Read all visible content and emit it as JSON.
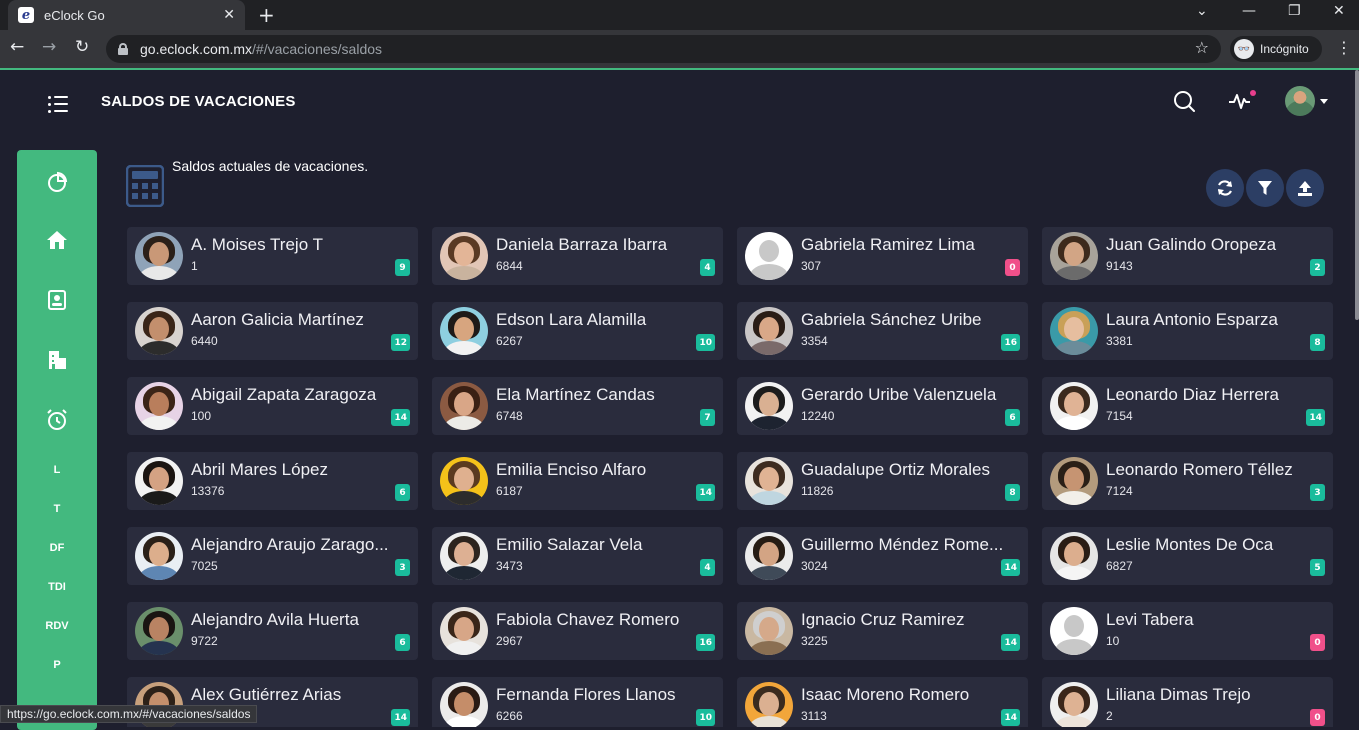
{
  "browser": {
    "tab_title": "eClock Go",
    "favicon_letter": "e",
    "new_tab": "+",
    "url_host": "go.eclock.com.mx",
    "url_path": "/#/vacaciones/saldos",
    "incognito_label": "Incógnito",
    "status_url": "https://go.eclock.com.mx/#/vacaciones/saldos"
  },
  "header": {
    "title": "SALDOS DE VACACIONES",
    "icons": [
      "search-icon",
      "activity-icon",
      "user-avatar"
    ],
    "notification_color": "#e83e8c"
  },
  "sidebar": {
    "color": "#43b97f",
    "icons": [
      "chart-pie-icon",
      "home-icon",
      "contact-card-icon",
      "building-icon",
      "alarm-clock-icon"
    ],
    "text_items": [
      "L",
      "T",
      "DF",
      "TDI",
      "RDV",
      "P"
    ]
  },
  "content": {
    "subtitle": "Saldos actuales de vacaciones.",
    "actions": [
      "refresh-icon",
      "filter-icon",
      "upload-icon"
    ]
  },
  "badge_colors": {
    "positive": "#1abc9c",
    "zero": "#f0508a"
  },
  "employees": [
    {
      "name": "A. Moises Trejo T",
      "id": "1",
      "days": "9",
      "avatar": "m1"
    },
    {
      "name": "Daniela Barraza Ibarra",
      "id": "6844",
      "days": "4",
      "avatar": "f1"
    },
    {
      "name": "Gabriela Ramirez Lima",
      "id": "307",
      "days": "0",
      "avatar": "none"
    },
    {
      "name": "Juan Galindo Oropeza",
      "id": "9143",
      "days": "2",
      "avatar": "m2"
    },
    {
      "name": "Aaron Galicia Martínez",
      "id": "6440",
      "days": "12",
      "avatar": "m3"
    },
    {
      "name": "Edson Lara Alamilla",
      "id": "6267",
      "days": "10",
      "avatar": "m4"
    },
    {
      "name": "Gabriela Sánchez Uribe",
      "id": "3354",
      "days": "16",
      "avatar": "f2"
    },
    {
      "name": "Laura Antonio Esparza",
      "id": "3381",
      "days": "8",
      "avatar": "f3"
    },
    {
      "name": "Abigail Zapata Zaragoza",
      "id": "100",
      "days": "14",
      "avatar": "f4"
    },
    {
      "name": "Ela Martínez Candas",
      "id": "6748",
      "days": "7",
      "avatar": "f5"
    },
    {
      "name": "Gerardo Uribe Valenzuela",
      "id": "12240",
      "days": "6",
      "avatar": "m5"
    },
    {
      "name": "Leonardo Diaz Herrera",
      "id": "7154",
      "days": "14",
      "avatar": "m6"
    },
    {
      "name": "Abril Mares López",
      "id": "13376",
      "days": "6",
      "avatar": "f6"
    },
    {
      "name": "Emilia Enciso Alfaro",
      "id": "6187",
      "days": "14",
      "avatar": "f7"
    },
    {
      "name": "Guadalupe Ortiz Morales",
      "id": "11826",
      "days": "8",
      "avatar": "f8"
    },
    {
      "name": "Leonardo Romero Téllez",
      "id": "7124",
      "days": "3",
      "avatar": "m7"
    },
    {
      "name": "Alejandro Araujo Zarago...",
      "id": "7025",
      "days": "3",
      "avatar": "m8"
    },
    {
      "name": "Emilio Salazar Vela",
      "id": "3473",
      "days": "4",
      "avatar": "m9"
    },
    {
      "name": "Guillermo Méndez Rome...",
      "id": "3024",
      "days": "14",
      "avatar": "m10"
    },
    {
      "name": "Leslie Montes De Oca",
      "id": "6827",
      "days": "5",
      "avatar": "f9"
    },
    {
      "name": "Alejandro Avila Huerta",
      "id": "9722",
      "days": "6",
      "avatar": "m11"
    },
    {
      "name": "Fabiola Chavez Romero",
      "id": "2967",
      "days": "16",
      "avatar": "f10"
    },
    {
      "name": "Ignacio Cruz Ramirez",
      "id": "3225",
      "days": "14",
      "avatar": "m12"
    },
    {
      "name": "Levi Tabera",
      "id": "10",
      "days": "0",
      "avatar": "none"
    },
    {
      "name": "Alex Gutiérrez Arias",
      "id": "",
      "days": "14",
      "avatar": "m13"
    },
    {
      "name": "Fernanda Flores Llanos",
      "id": "6266",
      "days": "10",
      "avatar": "f11"
    },
    {
      "name": "Isaac Moreno Romero",
      "id": "3113",
      "days": "14",
      "avatar": "m14"
    },
    {
      "name": "Liliana Dimas Trejo",
      "id": "2",
      "days": "0",
      "avatar": "f12"
    }
  ]
}
